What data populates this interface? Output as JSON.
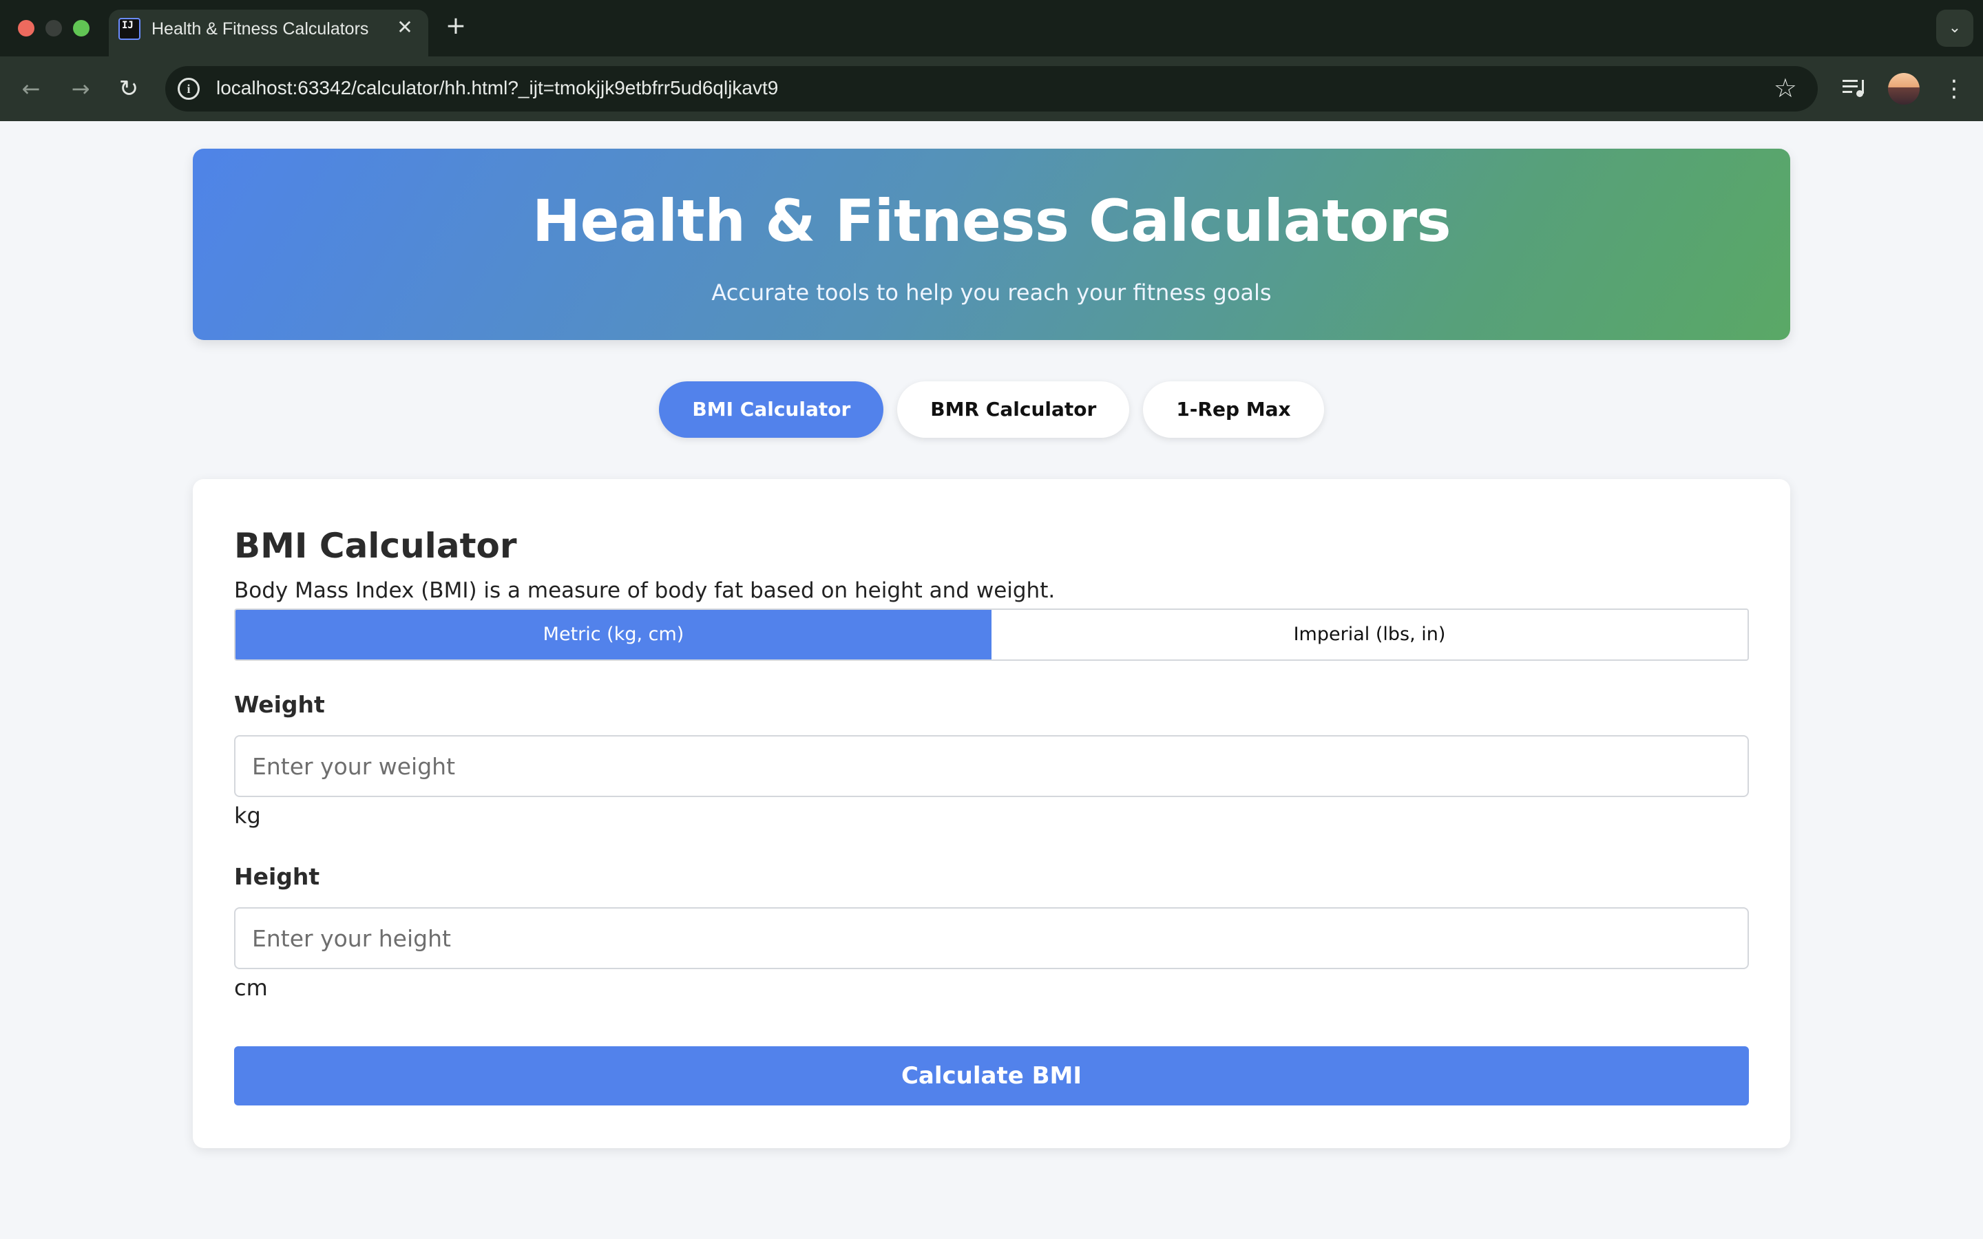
{
  "browser": {
    "tab_title": "Health & Fitness Calculators",
    "tab_favicon_text": "IJ",
    "tab_close_glyph": "✕",
    "new_tab_glyph": "+",
    "tab_menu_glyph": "⌄",
    "url": "localhost:63342/calculator/hh.html?_ijt=tmokjjk9etbfrr5ud6qljkavt9",
    "icons": [
      "back-arrow-icon",
      "forward-arrow-icon",
      "reload-icon",
      "site-info-icon",
      "bookmark-star-icon",
      "media-controls-icon",
      "profile-avatar",
      "more-menu-icon"
    ]
  },
  "header": {
    "title": "Health & Fitness Calculators",
    "subtitle": "Accurate tools to help you reach your fitness goals",
    "gradient_colors": [
      "#4f84e8",
      "#5aa866"
    ]
  },
  "nav_tabs": [
    {
      "label": "BMI Calculator",
      "active": true
    },
    {
      "label": "BMR Calculator",
      "active": false
    },
    {
      "label": "1-Rep Max",
      "active": false
    }
  ],
  "bmi": {
    "title": "BMI Calculator",
    "description": "Body Mass Index (BMI) is a measure of body fat based on height and weight.",
    "units": [
      {
        "label": "Metric (kg, cm)",
        "active": true
      },
      {
        "label": "Imperial (lbs, in)",
        "active": false
      }
    ],
    "weight": {
      "label": "Weight",
      "placeholder": "Enter your weight",
      "value": "",
      "unit": "kg"
    },
    "height": {
      "label": "Height",
      "placeholder": "Enter your height",
      "value": "",
      "unit": "cm"
    },
    "button_label": "Calculate BMI"
  },
  "colors": {
    "accent": "#5282eb",
    "page_bg": "#f4f6f9"
  }
}
